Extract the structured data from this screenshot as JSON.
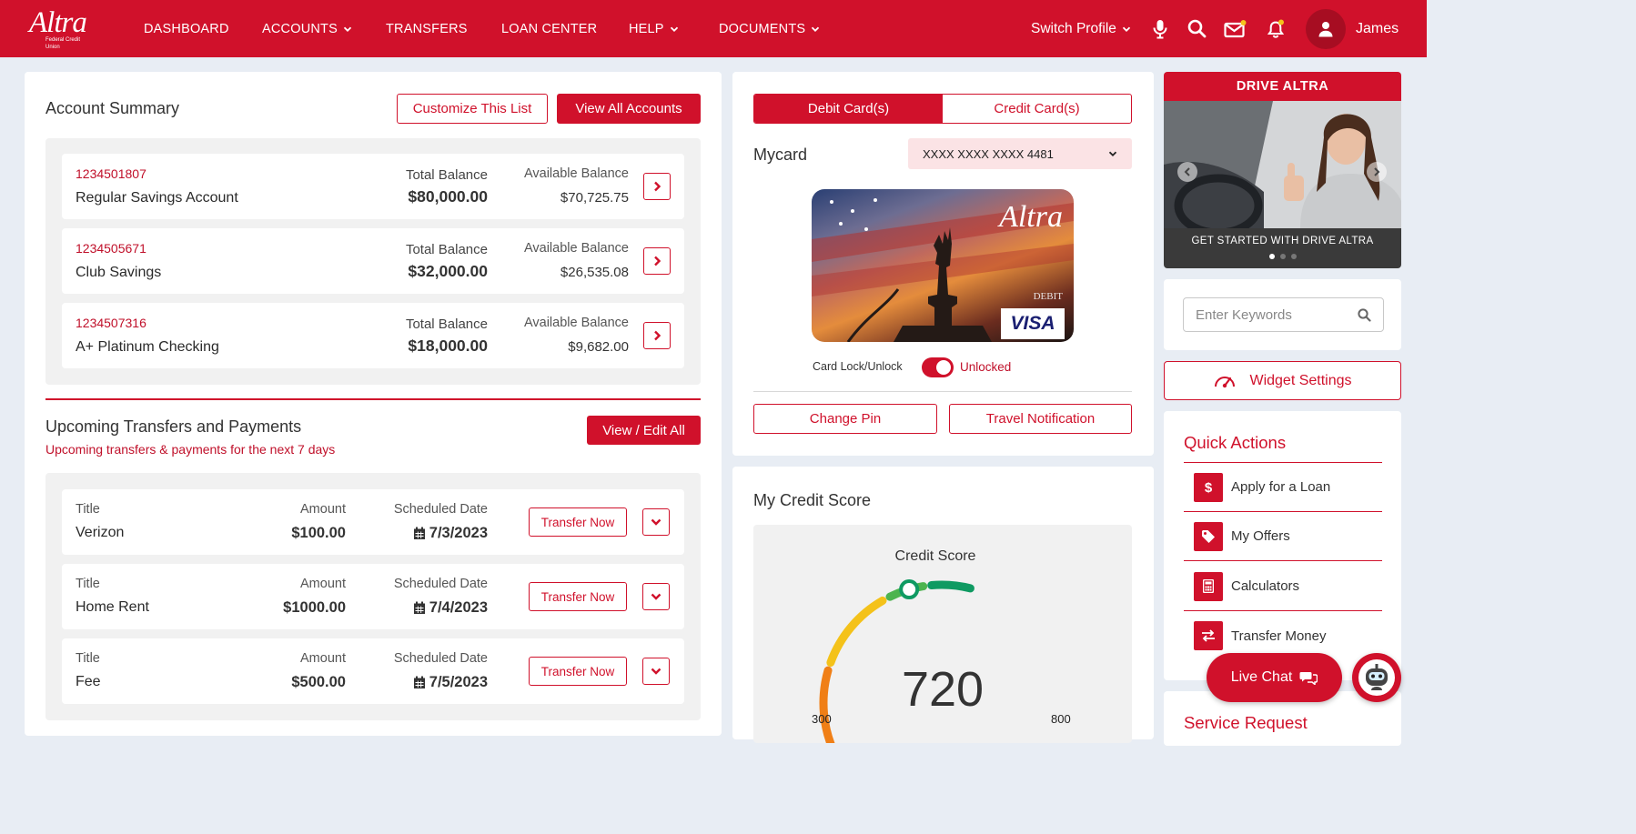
{
  "brand": {
    "logo_text": "Altra",
    "logo_sub": "Federal Credit Union",
    "accent": "#d0112b"
  },
  "nav": {
    "dashboard": "DASHBOARD",
    "accounts": "ACCOUNTS",
    "transfers": "TRANSFERS",
    "loan_center": "LOAN CENTER",
    "help": "HELP",
    "documents": "DOCUMENTS"
  },
  "header": {
    "switch_profile": "Switch Profile",
    "user_name": "James"
  },
  "account_summary": {
    "title": "Account Summary",
    "customize_label": "Customize This List",
    "view_all_label": "View All Accounts",
    "total_label": "Total Balance",
    "available_label": "Available Balance",
    "accounts": [
      {
        "number": "1234501807",
        "name": "Regular Savings Account",
        "total": "$80,000.00",
        "available": "$70,725.75"
      },
      {
        "number": "1234505671",
        "name": "Club Savings",
        "total": "$32,000.00",
        "available": "$26,535.08"
      },
      {
        "number": "1234507316",
        "name": "A+ Platinum Checking",
        "total": "$18,000.00",
        "available": "$9,682.00"
      }
    ]
  },
  "upcoming": {
    "title": "Upcoming Transfers and Payments",
    "subtitle": "Upcoming transfers & payments for the next 7 days",
    "view_edit_label": "View / Edit All",
    "col_title": "Title",
    "col_amount": "Amount",
    "col_date": "Scheduled Date",
    "transfer_label": "Transfer Now",
    "items": [
      {
        "title": "Verizon",
        "amount": "$100.00",
        "date": "7/3/2023"
      },
      {
        "title": "Home Rent",
        "amount": "$1000.00",
        "date": "7/4/2023"
      },
      {
        "title": "Fee",
        "amount": "$500.00",
        "date": "7/5/2023"
      }
    ]
  },
  "cards": {
    "debit_tab": "Debit Card(s)",
    "credit_tab": "Credit Card(s)",
    "mycard_label": "Mycard",
    "selected_card": "XXXX XXXX XXXX 4481",
    "card_brand": "Altra",
    "card_type": "DEBIT",
    "card_network": "VISA",
    "lock_label": "Card Lock/Unlock",
    "lock_state": "Unlocked",
    "change_pin": "Change Pin",
    "travel_notification": "Travel Notification"
  },
  "credit_score": {
    "title": "My Credit Score",
    "gauge_title": "Credit Score",
    "score": "720",
    "min": "300",
    "max": "800",
    "score_value": 720,
    "min_value": 300,
    "max_value": 800
  },
  "promo": {
    "title": "DRIVE ALTRA",
    "caption": "GET STARTED WITH DRIVE ALTRA",
    "slide_count": 3,
    "active_slide": 1
  },
  "search": {
    "placeholder": "Enter Keywords"
  },
  "widget_settings": {
    "label": "Widget Settings"
  },
  "quick_actions": {
    "title": "Quick Actions",
    "items": [
      {
        "label": "Apply for a Loan",
        "icon": "dollar-icon"
      },
      {
        "label": "My Offers",
        "icon": "tag-icon"
      },
      {
        "label": "Calculators",
        "icon": "calculator-icon"
      },
      {
        "label": "Transfer Money",
        "icon": "transfer-icon"
      }
    ]
  },
  "service_request": {
    "title": "Service Request"
  },
  "live_chat": {
    "label": "Live Chat"
  }
}
